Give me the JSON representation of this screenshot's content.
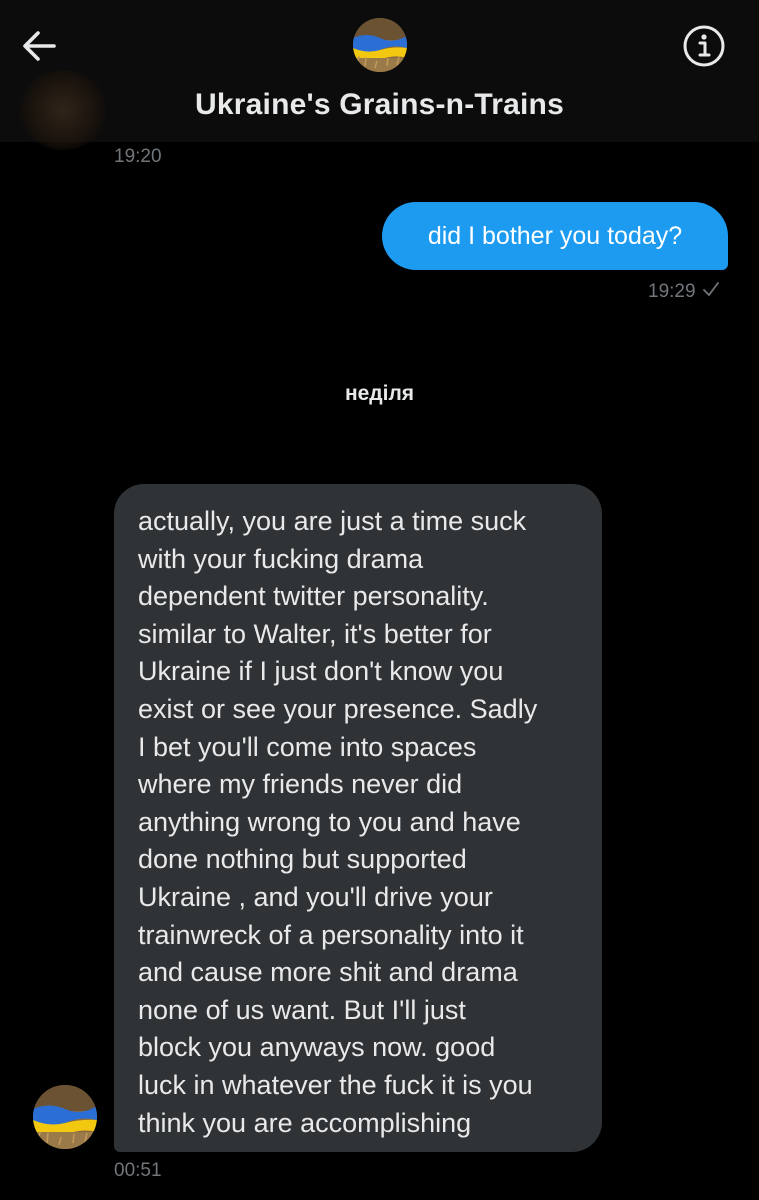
{
  "header": {
    "title": "Ukraine's Grains-n-Trains",
    "back_icon": "arrow-left-icon",
    "info_icon": "info-circle-icon"
  },
  "messages": [
    {
      "direction": "incoming",
      "time": "19:20"
    },
    {
      "direction": "outgoing",
      "text": "did I bother you today?",
      "time": "19:29",
      "status_icon": "check-icon"
    },
    {
      "direction": "incoming",
      "text": "actually, you are just a time suck\nwith your fucking drama\ndependent twitter personality.\nsimilar to Walter, it's better for\nUkraine if I just don't know you\nexist or see your presence.  Sadly\nI bet you'll come into spaces\nwhere my friends never did\nanything wrong to you and have\ndone nothing but supported\nUkraine , and you'll drive your\ntrainwreck of a personality into it\nand cause more shit and drama\nnone of us want.  But I'll just\nblock you anyways now.  good\nluck in whatever the fuck it is you\nthink you are accomplishing",
      "time": "00:51"
    }
  ],
  "day_separator": "неділя",
  "colors": {
    "background": "#000000",
    "header_bg": "#0c0c0c",
    "outgoing_bubble": "#1d9bf0",
    "incoming_bubble": "#2f3336",
    "timestamp": "#71767b",
    "text": "#e7e9ea",
    "flag_blue": "#2b6fd6",
    "flag_yellow": "#f2c811"
  }
}
